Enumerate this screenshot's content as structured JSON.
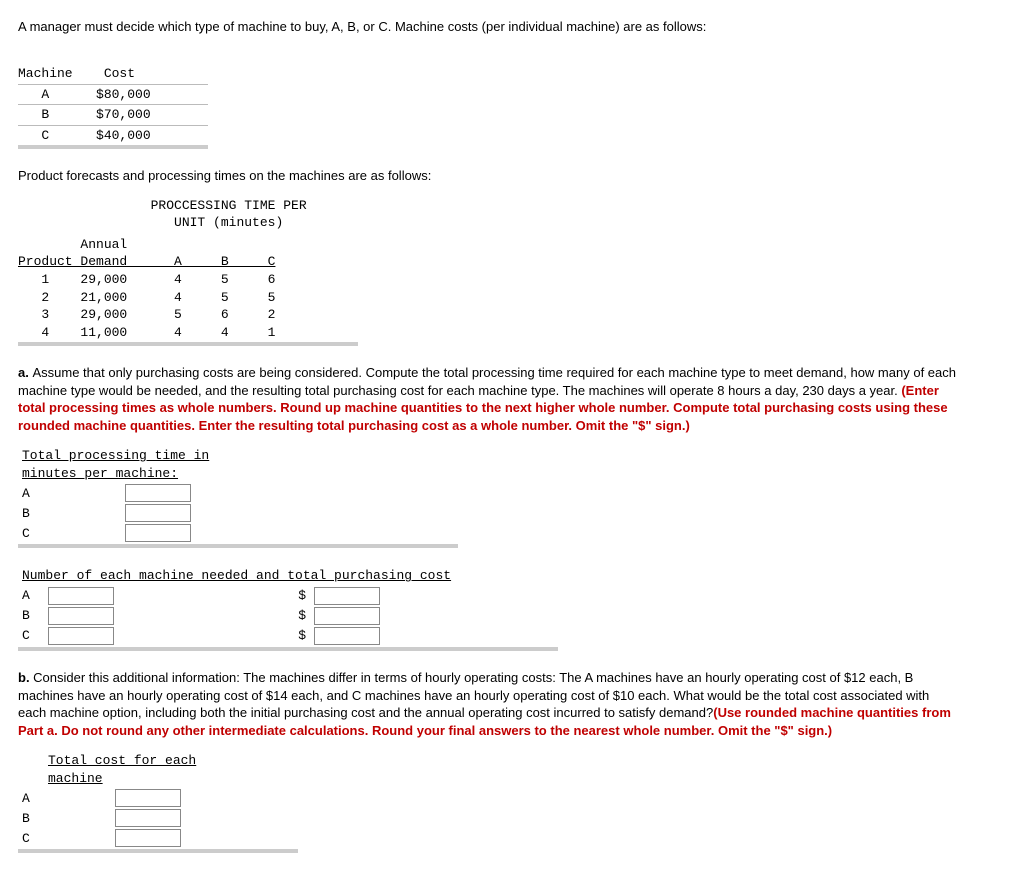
{
  "intro": "A manager must decide which type of machine to buy, A, B, or C. Machine costs (per individual machine) are as follows:",
  "machine_cost_table": {
    "headers": {
      "col1": "Machine",
      "col2": "Cost"
    },
    "rows": [
      {
        "machine": "A",
        "cost": "$80,000"
      },
      {
        "machine": "B",
        "cost": "$70,000"
      },
      {
        "machine": "C",
        "cost": "$40,000"
      }
    ],
    "col1": "  A\n  B\n  C",
    "col2": " $80,000\n $70,000\n $40,000"
  },
  "forecast_intro": "Product forecasts and processing times on the machines are as follows:",
  "proc_table": {
    "title1": "PROCCESSING TIME PER",
    "title2": "UNIT (minutes)",
    "annual_lbl": "Annual",
    "headers": "Product Demand      A     B     C",
    "rows": [
      {
        "product": "1",
        "demand": "29,000",
        "A": "4",
        "B": "5",
        "C": "6"
      },
      {
        "product": "2",
        "demand": "21,000",
        "A": "4",
        "B": "5",
        "C": "5"
      },
      {
        "product": "3",
        "demand": "29,000",
        "A": "5",
        "B": "6",
        "C": "2"
      },
      {
        "product": "4",
        "demand": "11,000",
        "A": "4",
        "B": "4",
        "C": "1"
      }
    ],
    "body": "   1    29,000      4     5     6\n   2    21,000      4     5     5\n   3    29,000      5     6     2\n   4    11,000      4     4     1"
  },
  "part_a": {
    "prefix": "a. ",
    "text": "Assume that only purchasing costs are being considered. Compute the total processing time required for each machine type to meet demand, how many of each machine type would be needed, and the resulting total purchasing cost for each machine type. The machines will operate 8 hours a day, 230 days a year. ",
    "red": "(Enter total processing times as whole numbers. Round up machine quantities to the next higher whole number. Compute total purchasing costs using these rounded machine quantities. Enter the resulting total purchasing cost as a whole number. Omit the \"$\" sign.)"
  },
  "tpt": {
    "header": "Total processing time in minutes per machine:",
    "rows": [
      "A",
      "B",
      "C"
    ]
  },
  "nmn": {
    "header": "Number of each machine needed and total purchasing cost",
    "rows": [
      "A",
      "B",
      "C"
    ],
    "dollar": "$"
  },
  "part_b": {
    "prefix": "b. ",
    "text": "Consider this additional information: The machines differ in terms of hourly operating costs: The A machines have an hourly operating cost of $12 each, B machines have an hourly operating cost of $14 each, and C machines have an hourly operating cost of $10 each. What would be the total cost associated with each machine option, including both the initial purchasing cost and the annual operating cost incurred to satisfy demand?",
    "red": "(Use rounded machine quantities from Part a. Do not round any other intermediate calculations. Round your final answers to the nearest whole number. Omit the \"$\" sign.)"
  },
  "tcf": {
    "header": "Total cost for each machine",
    "rows": [
      "A",
      "B",
      "C"
    ]
  }
}
